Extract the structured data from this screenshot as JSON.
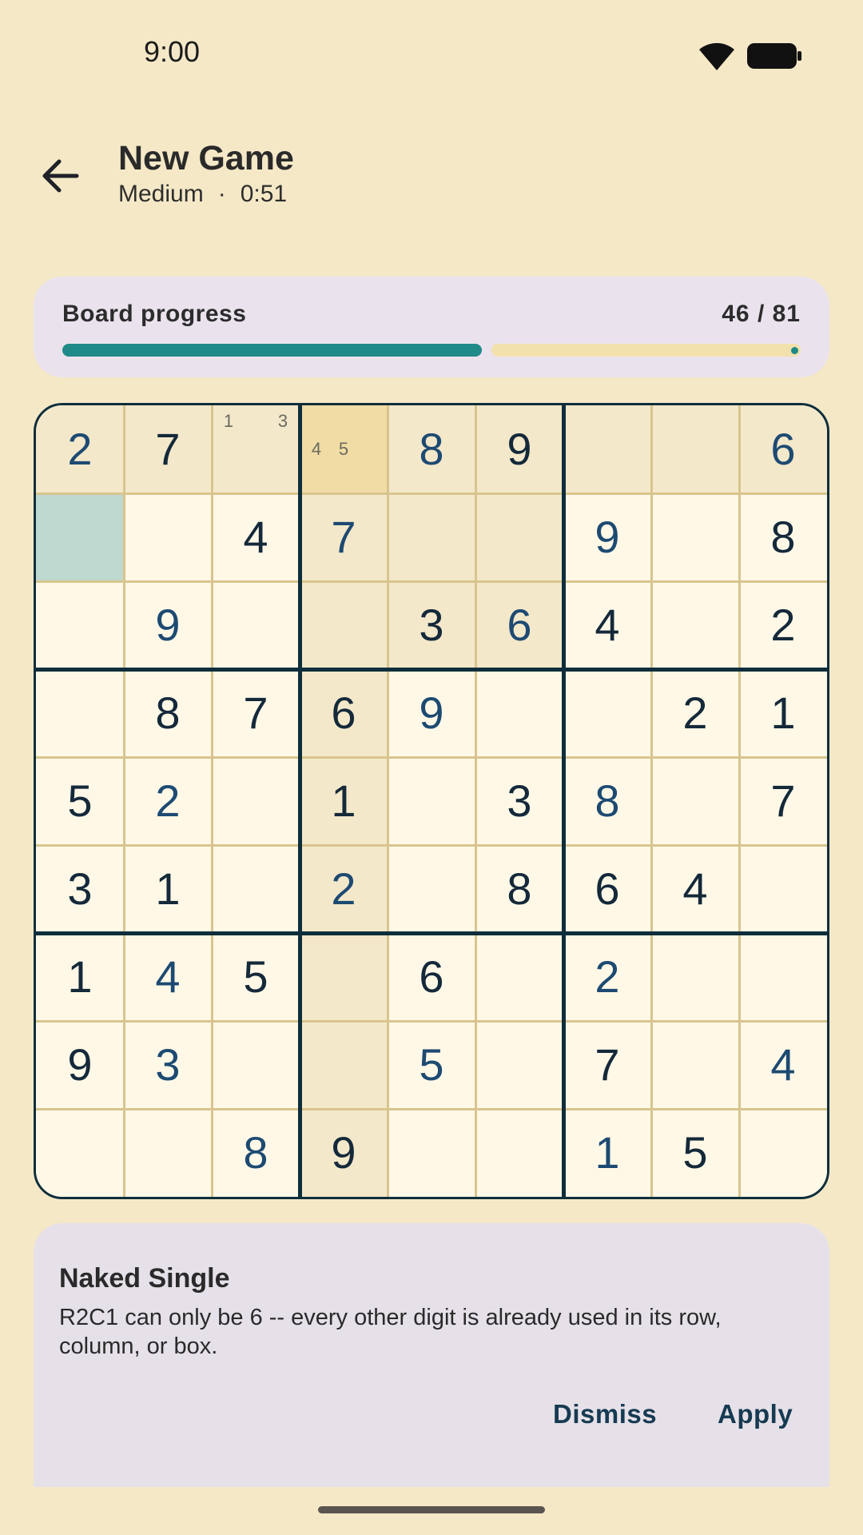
{
  "status_bar": {
    "time": "9:00",
    "icons": [
      "wifi-icon",
      "battery-icon"
    ]
  },
  "header": {
    "back_icon": "arrow-back-icon",
    "title": "New Game",
    "difficulty": "Medium",
    "separator": "·",
    "timer": "0:51"
  },
  "progress": {
    "label": "Board progress",
    "count_text": "46 / 81",
    "filled": 46,
    "total": 81,
    "fill_color": "#1F8A87",
    "track_color": "#F2E1AC"
  },
  "board": {
    "selected_cell": "R2C1",
    "colors": {
      "cell_default": "#FFF8E7",
      "cell_related": "#F3E8CA",
      "cell_note_highlight": "#F0DCA4",
      "cell_selected": "#BFD9D1",
      "given_digit": "#14293A",
      "user_digit": "#1D4A72"
    },
    "rows": [
      [
        {
          "v": "2",
          "t": "user",
          "bg": "related"
        },
        {
          "v": "7",
          "t": "given",
          "bg": "related"
        },
        {
          "v": "",
          "notes": [
            "1",
            "",
            "3",
            "",
            "",
            "",
            "",
            "",
            ""
          ],
          "bg": "related"
        },
        {
          "v": "",
          "notes": [
            "4",
            "5",
            "",
            "",
            "",
            "",
            "",
            "",
            ""
          ],
          "notes_row": 1,
          "bg": "note_highlight"
        },
        {
          "v": "8",
          "t": "user",
          "bg": "related"
        },
        {
          "v": "9",
          "t": "given",
          "bg": "related"
        },
        {
          "v": "",
          "bg": "related"
        },
        {
          "v": "",
          "bg": "related"
        },
        {
          "v": "6",
          "t": "user",
          "bg": "related"
        }
      ],
      [
        {
          "v": "",
          "bg": "selected"
        },
        {
          "v": "",
          "bg": "default"
        },
        {
          "v": "4",
          "t": "given",
          "bg": "default"
        },
        {
          "v": "7",
          "t": "user",
          "bg": "related"
        },
        {
          "v": "",
          "bg": "related"
        },
        {
          "v": "",
          "bg": "related"
        },
        {
          "v": "9",
          "t": "user",
          "bg": "default"
        },
        {
          "v": "",
          "bg": "default"
        },
        {
          "v": "8",
          "t": "given",
          "bg": "default"
        }
      ],
      [
        {
          "v": "",
          "bg": "default"
        },
        {
          "v": "9",
          "t": "user",
          "bg": "default"
        },
        {
          "v": "",
          "bg": "default"
        },
        {
          "v": "",
          "bg": "related"
        },
        {
          "v": "3",
          "t": "given",
          "bg": "related"
        },
        {
          "v": "6",
          "t": "user",
          "bg": "related"
        },
        {
          "v": "4",
          "t": "given",
          "bg": "default"
        },
        {
          "v": "",
          "bg": "default"
        },
        {
          "v": "2",
          "t": "given",
          "bg": "default"
        }
      ],
      [
        {
          "v": "",
          "bg": "default"
        },
        {
          "v": "8",
          "t": "given",
          "bg": "default"
        },
        {
          "v": "7",
          "t": "given",
          "bg": "default"
        },
        {
          "v": "6",
          "t": "given",
          "bg": "related"
        },
        {
          "v": "9",
          "t": "user",
          "bg": "default"
        },
        {
          "v": "",
          "bg": "default"
        },
        {
          "v": "",
          "bg": "default"
        },
        {
          "v": "2",
          "t": "given",
          "bg": "default"
        },
        {
          "v": "1",
          "t": "given",
          "bg": "default"
        }
      ],
      [
        {
          "v": "5",
          "t": "given",
          "bg": "default"
        },
        {
          "v": "2",
          "t": "user",
          "bg": "default"
        },
        {
          "v": "",
          "bg": "default"
        },
        {
          "v": "1",
          "t": "given",
          "bg": "related"
        },
        {
          "v": "",
          "bg": "default"
        },
        {
          "v": "3",
          "t": "given",
          "bg": "default"
        },
        {
          "v": "8",
          "t": "user",
          "bg": "default"
        },
        {
          "v": "",
          "bg": "default"
        },
        {
          "v": "7",
          "t": "given",
          "bg": "default"
        }
      ],
      [
        {
          "v": "3",
          "t": "given",
          "bg": "default"
        },
        {
          "v": "1",
          "t": "given",
          "bg": "default"
        },
        {
          "v": "",
          "bg": "default"
        },
        {
          "v": "2",
          "t": "user",
          "bg": "related"
        },
        {
          "v": "",
          "bg": "default"
        },
        {
          "v": "8",
          "t": "given",
          "bg": "default"
        },
        {
          "v": "6",
          "t": "given",
          "bg": "default"
        },
        {
          "v": "4",
          "t": "given",
          "bg": "default"
        },
        {
          "v": "",
          "bg": "default"
        }
      ],
      [
        {
          "v": "1",
          "t": "given",
          "bg": "default"
        },
        {
          "v": "4",
          "t": "user",
          "bg": "default"
        },
        {
          "v": "5",
          "t": "given",
          "bg": "default"
        },
        {
          "v": "",
          "bg": "related"
        },
        {
          "v": "6",
          "t": "given",
          "bg": "default"
        },
        {
          "v": "",
          "bg": "default"
        },
        {
          "v": "2",
          "t": "user",
          "bg": "default"
        },
        {
          "v": "",
          "bg": "default"
        },
        {
          "v": "",
          "bg": "default"
        }
      ],
      [
        {
          "v": "9",
          "t": "given",
          "bg": "default"
        },
        {
          "v": "3",
          "t": "user",
          "bg": "default"
        },
        {
          "v": "",
          "bg": "default"
        },
        {
          "v": "",
          "bg": "related"
        },
        {
          "v": "5",
          "t": "user",
          "bg": "default"
        },
        {
          "v": "",
          "bg": "default"
        },
        {
          "v": "7",
          "t": "given",
          "bg": "default"
        },
        {
          "v": "",
          "bg": "default"
        },
        {
          "v": "4",
          "t": "user",
          "bg": "default"
        }
      ],
      [
        {
          "v": "",
          "bg": "default"
        },
        {
          "v": "",
          "bg": "default"
        },
        {
          "v": "8",
          "t": "user",
          "bg": "default"
        },
        {
          "v": "9",
          "t": "given",
          "bg": "related"
        },
        {
          "v": "",
          "bg": "default"
        },
        {
          "v": "",
          "bg": "default"
        },
        {
          "v": "1",
          "t": "user",
          "bg": "default"
        },
        {
          "v": "5",
          "t": "given",
          "bg": "default"
        },
        {
          "v": "",
          "bg": "default"
        }
      ]
    ]
  },
  "hint": {
    "title": "Naked Single",
    "body": "R2C1 can only be 6 -- every other digit is already used in its row, column, or box.",
    "dismiss_label": "Dismiss",
    "apply_label": "Apply"
  }
}
